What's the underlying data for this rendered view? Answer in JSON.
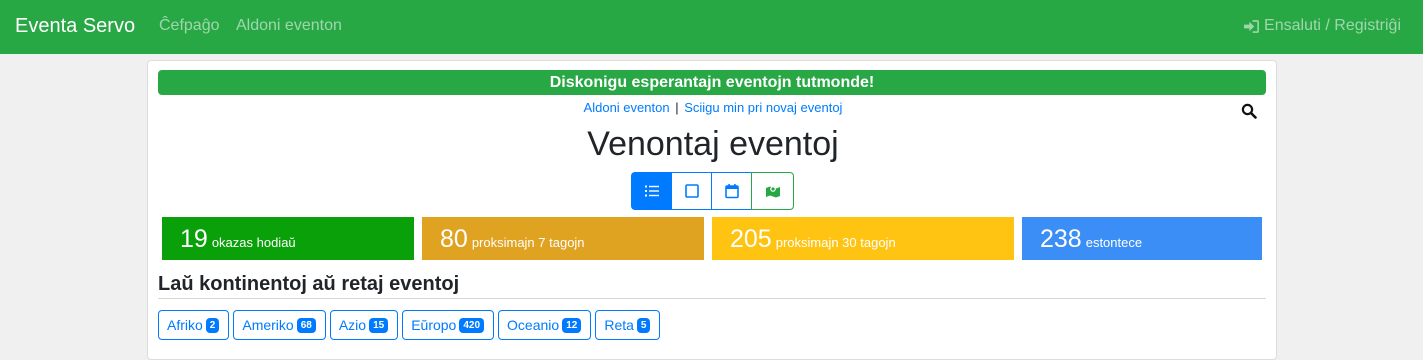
{
  "navbar": {
    "brand": "Eventa Servo",
    "links": [
      "Ĉefpaĝo",
      "Aldoni eventon"
    ],
    "login": "Ensaluti / Registriĝi"
  },
  "banner": "Diskonigu esperantajn eventojn tutmonde!",
  "sublinks": {
    "add": "Aldoni eventon",
    "separator": "|",
    "subscribe": "Sciigu min pri novaj eventoj"
  },
  "title": "Venontaj eventoj",
  "view_buttons": [
    "list-icon",
    "square-icon",
    "calendar-icon",
    "map-icon"
  ],
  "stats": [
    {
      "number": "19",
      "label": "okazas hodiaŭ",
      "color": "#0aa00a"
    },
    {
      "number": "80",
      "label": "proksimajn 7 tagojn",
      "color": "#e0a321"
    },
    {
      "number": "205",
      "label": "proksimajn 30 tagojn",
      "color": "#ffc311"
    },
    {
      "number": "238",
      "label": "estontece",
      "color": "#3b8ef5"
    }
  ],
  "section_title": "Laŭ kontinentoj aŭ retaj eventoj",
  "continents": [
    {
      "name": "Afriko",
      "count": "2"
    },
    {
      "name": "Ameriko",
      "count": "68"
    },
    {
      "name": "Azio",
      "count": "15"
    },
    {
      "name": "Eŭropo",
      "count": "420"
    },
    {
      "name": "Oceanio",
      "count": "12"
    },
    {
      "name": "Reta",
      "count": "5"
    }
  ]
}
